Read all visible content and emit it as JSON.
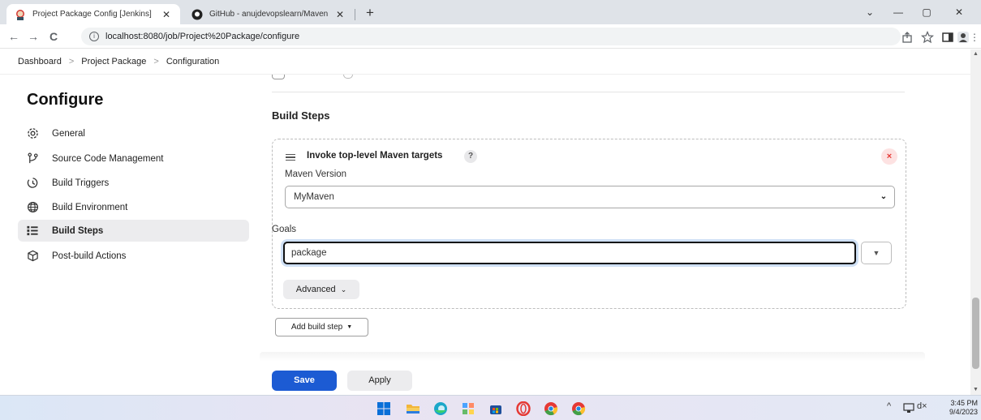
{
  "browser": {
    "tabs": [
      {
        "title": "Project Package Config [Jenkins]",
        "active": true
      },
      {
        "title": "GitHub - anujdevopslearn/Maven",
        "active": false
      }
    ],
    "tab_close": "✕",
    "new_tab": "+",
    "window_controls": {
      "dropdown": "⌄",
      "minimize": "—",
      "restore": "▢",
      "close": "✕"
    },
    "nav": {
      "back": "←",
      "forward": "→",
      "reload": "C"
    },
    "info_icon": "i",
    "url": "localhost:8080/job/Project%20Package/configure"
  },
  "breadcrumbs": {
    "items": [
      "Dashboard",
      "Project Package",
      "Configuration"
    ],
    "separator": ">"
  },
  "sidebar": {
    "title": "Configure",
    "items": [
      {
        "label": "General",
        "icon": "gear-icon",
        "active": false
      },
      {
        "label": "Source Code Management",
        "icon": "branch-icon",
        "active": false
      },
      {
        "label": "Build Triggers",
        "icon": "clock-icon",
        "active": false
      },
      {
        "label": "Build Environment",
        "icon": "globe-icon",
        "active": false
      },
      {
        "label": "Build Steps",
        "icon": "list-icon",
        "active": true
      },
      {
        "label": "Post-build Actions",
        "icon": "cube-icon",
        "active": false
      }
    ]
  },
  "main": {
    "section_title": "Build Steps",
    "step": {
      "title": "Invoke top-level Maven targets",
      "help": "?",
      "delete": "×",
      "maven_version_label": "Maven Version",
      "maven_version_value": "MyMaven",
      "goals_label": "Goals",
      "goals_value": "package",
      "advanced_label": "Advanced"
    },
    "add_build_step_label": "Add build step",
    "save_label": "Save",
    "apply_label": "Apply"
  },
  "taskbar": {
    "clock_time": "3:45 PM",
    "clock_date": "9/4/2023",
    "tray_chevron": "^",
    "volume": "d×"
  },
  "colors": {
    "accent": "#1c5bd3",
    "delete_bg": "#fde2e2",
    "delete_fg": "#e53935",
    "active_item_bg": "#ececee"
  }
}
